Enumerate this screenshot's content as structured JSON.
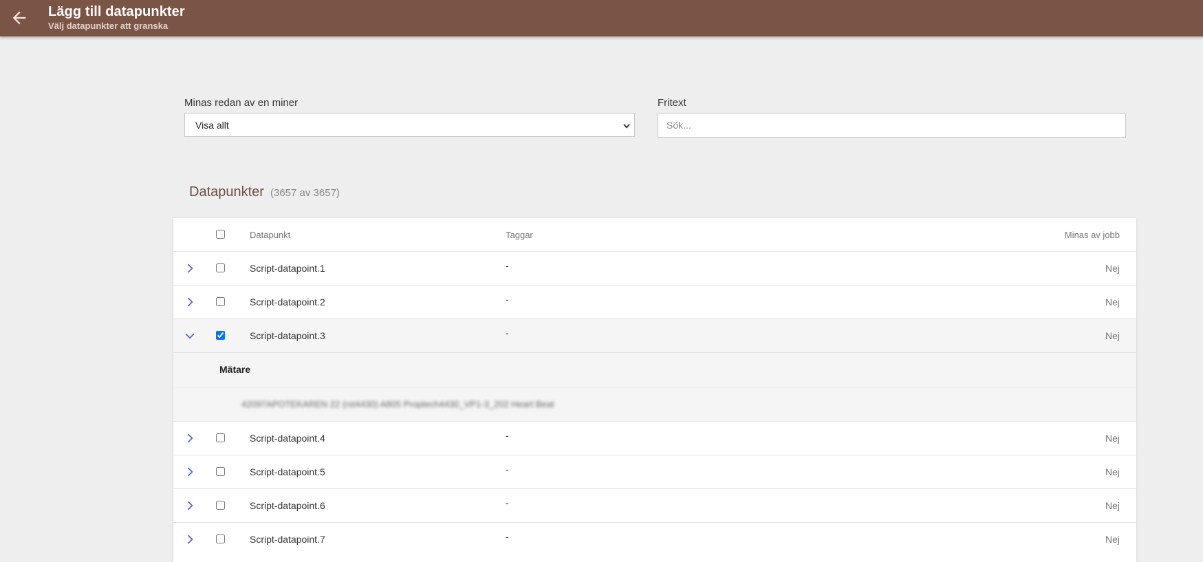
{
  "header": {
    "title": "Lägg till datapunkter",
    "subtitle": "Välj datapunkter att granska",
    "back_icon": "arrow-left-icon",
    "bg_color": "#7a5546"
  },
  "filters": {
    "miner_label": "Minas redan av en miner",
    "miner_selected": "Visa allt",
    "text_label": "Fritext",
    "text_placeholder": "Sök...",
    "text_value": ""
  },
  "datapoints": {
    "title": "Datapunkter",
    "count": "(3657 av 3657)",
    "columns": {
      "name": "Datapunkt",
      "tags": "Taggar",
      "used": "Minas av jobb"
    },
    "rows": [
      {
        "name": "Script-datapoint.1",
        "tags": "-",
        "used": "Nej",
        "checked": false,
        "expanded": false
      },
      {
        "name": "Script-datapoint.2",
        "tags": "-",
        "used": "Nej",
        "checked": false,
        "expanded": false
      },
      {
        "name": "Script-datapoint.3",
        "tags": "-",
        "used": "Nej",
        "checked": true,
        "expanded": true
      },
      {
        "name": "Script-datapoint.4",
        "tags": "-",
        "used": "Nej",
        "checked": false,
        "expanded": false
      },
      {
        "name": "Script-datapoint.5",
        "tags": "-",
        "used": "Nej",
        "checked": false,
        "expanded": false
      },
      {
        "name": "Script-datapoint.6",
        "tags": "-",
        "used": "Nej",
        "checked": false,
        "expanded": false
      },
      {
        "name": "Script-datapoint.7",
        "tags": "-",
        "used": "Nej",
        "checked": false,
        "expanded": false
      }
    ],
    "expanded_detail": {
      "title": "Mätare",
      "item": "42097APOTEKAREN 22 (rst4430) A805 Proptech4430_VP1-3_202 Heart Beat"
    }
  },
  "colors": {
    "accent": "#7a5546",
    "section_title": "#6d4e43",
    "chevron": "#5c6bc0"
  }
}
